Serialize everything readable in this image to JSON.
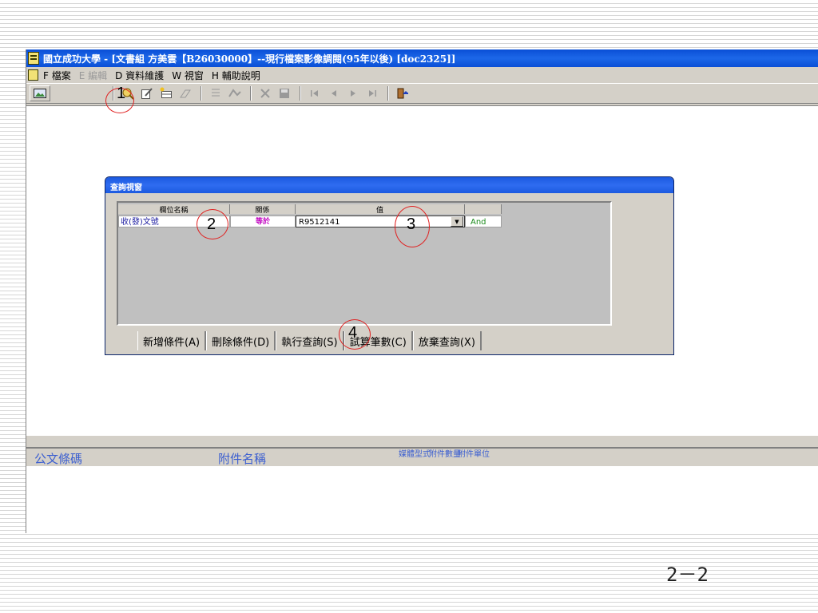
{
  "window": {
    "title": "國立成功大學 - [文書組 方美雲【B26030000】--現行檔案影像調閱(95年以後) [doc2325]]"
  },
  "menubar": {
    "items": [
      "F 檔案",
      "E 編輯",
      "D 資料維護",
      "W 視窗",
      "H 輔助說明"
    ]
  },
  "toolbar": {
    "icons": [
      "picture-icon",
      "query-icon",
      "edit-icon",
      "new-icon",
      "erase-icon",
      "list-icon",
      "sign-icon",
      "delete-icon",
      "save-icon",
      "first-icon",
      "prev-icon",
      "next-icon",
      "last-icon",
      "exit-icon"
    ]
  },
  "dialog": {
    "title": "查詢視窗",
    "columns": [
      "欄位名稱",
      "關係",
      "值"
    ],
    "row": {
      "field": "收(發)文號",
      "relation": "等於",
      "value": "R9512141",
      "logic": "And"
    },
    "buttons": [
      "新增條件(A)",
      "刪除條件(D)",
      "執行查詢(S)",
      "試算筆數(C)",
      "放棄查詢(X)"
    ]
  },
  "lower_table": {
    "headers": [
      "公文條碼",
      "附件名稱",
      "媒體型式",
      "附件數量",
      "附件單位"
    ]
  },
  "annotations": [
    "1",
    "2",
    "3",
    "4"
  ],
  "slide": {
    "page_number": "2－2"
  },
  "colors": {
    "titlebar": "#0a4fd6",
    "field_text": "#1a1aa0",
    "relation_text": "#c000c0",
    "logic_text": "#1a8a1a",
    "header_text": "#3c5fd0",
    "annotation": "#e02020"
  }
}
